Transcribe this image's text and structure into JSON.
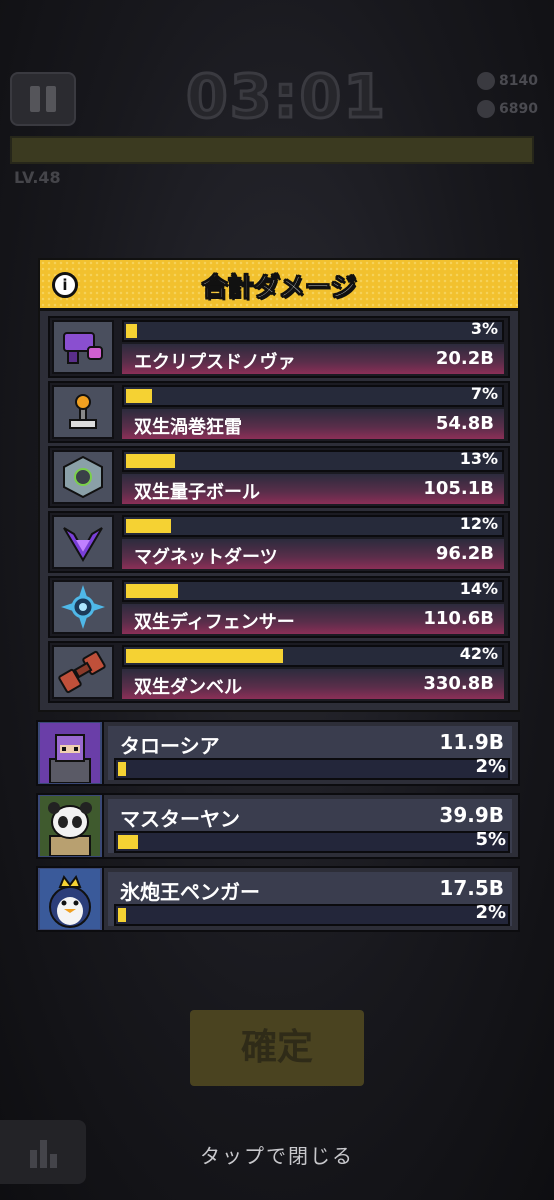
{
  "hud": {
    "timer": "03:01",
    "coins": "8140",
    "kills": "6890",
    "level": "LV.48"
  },
  "panel": {
    "title": "合計ダメージ",
    "info_icon": "info-icon"
  },
  "weapons": [
    {
      "name": "エクリプスドノヴァ",
      "damage": "20.2B",
      "percent_label": "3%",
      "percent": 3,
      "icon": "eclipse-gun-icon",
      "icon_color": "#8a4fd0"
    },
    {
      "name": "双生渦巻狂雷",
      "damage": "54.8B",
      "percent_label": "7%",
      "percent": 7,
      "icon": "lightning-tower-icon",
      "icon_color": "#f0a020"
    },
    {
      "name": "双生量子ボール",
      "damage": "105.1B",
      "percent_label": "13%",
      "percent": 13,
      "icon": "quantum-ball-icon",
      "icon_color": "#8aa0a8"
    },
    {
      "name": "マグネットダーツ",
      "damage": "96.2B",
      "percent_label": "12%",
      "percent": 12,
      "icon": "magnet-dart-icon",
      "icon_color": "#7a3fd8"
    },
    {
      "name": "双生ディフェンサー",
      "damage": "110.6B",
      "percent_label": "14%",
      "percent": 14,
      "icon": "defender-icon",
      "icon_color": "#4fb8e8"
    },
    {
      "name": "双生ダンベル",
      "damage": "330.8B",
      "percent_label": "42%",
      "percent": 42,
      "icon": "dumbbell-icon",
      "icon_color": "#c0503a"
    }
  ],
  "companions": [
    {
      "name": "タローシア",
      "damage": "11.9B",
      "percent_label": "2%",
      "percent": 2,
      "icon": "taroshia-portrait",
      "bg": "#6a3ea8"
    },
    {
      "name": "マスターヤン",
      "damage": "39.9B",
      "percent_label": "5%",
      "percent": 5,
      "icon": "master-yan-portrait",
      "bg": "#3f5a2e"
    },
    {
      "name": "氷炮王ペンガー",
      "damage": "17.5B",
      "percent_label": "2%",
      "percent": 2,
      "icon": "penguin-king-portrait",
      "bg": "#3a5a9a"
    }
  ],
  "confirm_button": "確定",
  "close_hint": "タップで閉じる"
}
